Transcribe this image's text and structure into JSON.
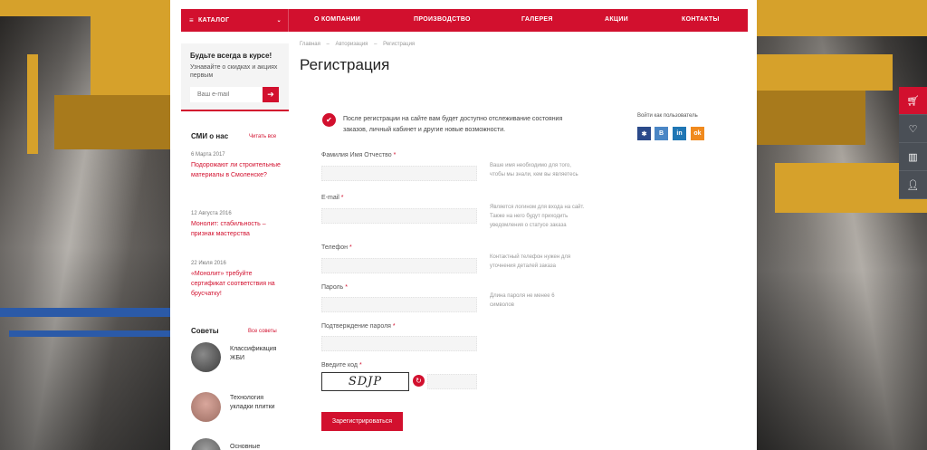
{
  "nav": {
    "catalog": "КАТАЛОГ",
    "items": [
      "О КОМПАНИИ",
      "ПРОИЗВОДСТВО",
      "ГАЛЕРЕЯ",
      "АКЦИИ",
      "КОНТАКТЫ"
    ]
  },
  "subscribe": {
    "title": "Будьте всегда в курсе!",
    "subtitle": "Узнавайте о скидках и акциях первым",
    "placeholder": "Ваш e-mail"
  },
  "media": {
    "title": "СМИ о нас",
    "link": "Читать все",
    "items": [
      {
        "date": "6 Марта 2017",
        "text": "Подорожают ли строительные материалы в Смоленске?"
      },
      {
        "date": "12 Августа 2016",
        "text": "Монолит: стабильность – признак мастерства"
      },
      {
        "date": "22 Июля 2016",
        "text": "«Монолит» требуйте сертификат соответствия на брусчатку!"
      }
    ]
  },
  "tips": {
    "title": "Советы",
    "link": "Все советы",
    "items": [
      {
        "text": "Классификация ЖБИ"
      },
      {
        "text": "Технология укладки плитки"
      },
      {
        "text": "Основные"
      }
    ]
  },
  "breadcrumb": [
    "Главная",
    "–",
    "Авторизация",
    "–",
    "Регистрация"
  ],
  "page_title": "Регистрация",
  "intro": "После регистрации на сайте вам будет доступно отслеживание состояния заказов, личный кабинет и другие новые возможности.",
  "social": {
    "title": "Войти как пользователь",
    "buttons": [
      {
        "label": "✱",
        "color": "#2b4a8a"
      },
      {
        "label": "B",
        "color": "#4a86c5"
      },
      {
        "label": "in",
        "color": "#1f76b4"
      },
      {
        "label": "ok",
        "color": "#f08a1e"
      }
    ]
  },
  "form": {
    "fields": [
      {
        "label": "Фамилия Имя Отчество",
        "hint": "Ваше имя необходимо для того, чтобы мы знали, кем вы являетесь"
      },
      {
        "label": "E-mail",
        "hint": "Является логином для входа на сайт. Также на него будут приходить уведомления о статусе заказа"
      },
      {
        "label": "Телефон",
        "hint": "Контактный телефон нужен для уточнения деталей заказа"
      },
      {
        "label": "Пароль",
        "hint": "Длина пароля не менее 6 символов"
      },
      {
        "label": "Подтверждение пароля",
        "hint": ""
      }
    ],
    "captcha_label": "Введите код",
    "captcha_text": "SDJP",
    "required_mark": "*",
    "submit": "Зарегистрироваться"
  },
  "right_panel": [
    "cart-icon",
    "heart-icon",
    "chart-icon",
    "user-icon"
  ]
}
